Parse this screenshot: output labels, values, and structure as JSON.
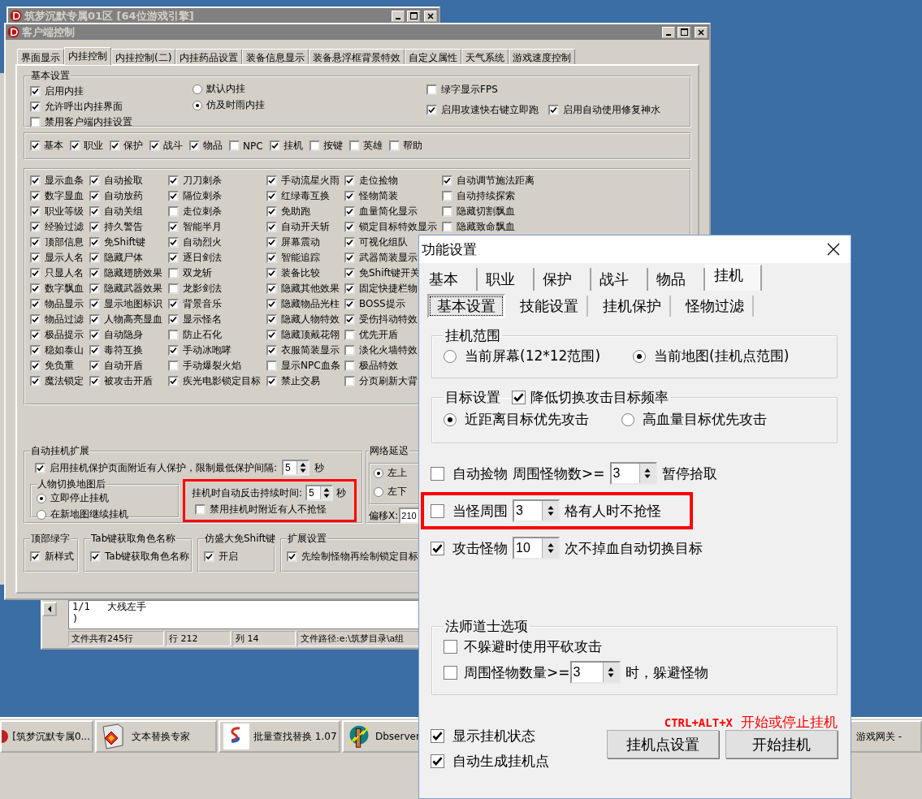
{
  "game_window": {
    "title": "筑梦沉默专属01区 [64位游戏引擎]"
  },
  "client_window": {
    "title": "客户端控制",
    "tabs": [
      {
        "label": "界面显示",
        "selected": false
      },
      {
        "label": "内挂控制",
        "selected": true
      },
      {
        "label": "内挂控制(二)",
        "selected": false
      },
      {
        "label": "内挂药品设置",
        "selected": false
      },
      {
        "label": "装备信息显示",
        "selected": false
      },
      {
        "label": "装备悬浮框背景特效",
        "selected": false
      },
      {
        "label": "自定义属性",
        "selected": false
      },
      {
        "label": "天气系统",
        "selected": false
      },
      {
        "label": "游戏速度控制",
        "selected": false
      }
    ],
    "basic_settings": {
      "title": "基本设置",
      "checkboxes": [
        {
          "label": "启用内挂",
          "checked": true
        },
        {
          "label": "允许呼出内挂界面",
          "checked": true
        },
        {
          "label": "禁用客户端内挂设置",
          "checked": false
        }
      ],
      "radios": [
        {
          "label": "默认内挂",
          "selected": false
        },
        {
          "label": "仿及时雨内挂",
          "selected": true
        }
      ],
      "right_checkboxes": [
        {
          "label": "绿字显示FPS",
          "checked": false
        },
        {
          "label": "启用攻速快右键立即跑",
          "checked": true
        },
        {
          "label": "启用自动使用修复神水",
          "checked": true
        }
      ]
    },
    "categories": [
      {
        "label": "基本",
        "checked": true
      },
      {
        "label": "职业",
        "checked": true
      },
      {
        "label": "保护",
        "checked": true
      },
      {
        "label": "战斗",
        "checked": true
      },
      {
        "label": "物品",
        "checked": true
      },
      {
        "label": "NPC",
        "checked": false
      },
      {
        "label": "挂机",
        "checked": true
      },
      {
        "label": "按键",
        "checked": false
      },
      {
        "label": "英雄",
        "checked": false
      },
      {
        "label": "帮助",
        "checked": false
      }
    ],
    "feature_columns": [
      [
        {
          "label": "显示血条",
          "checked": true
        },
        {
          "label": "数字显血",
          "checked": true
        },
        {
          "label": "职业等级",
          "checked": true
        },
        {
          "label": "经验过滤",
          "checked": true
        },
        {
          "label": "顶部信息",
          "checked": true
        },
        {
          "label": "显示人名",
          "checked": true
        },
        {
          "label": "只显人名",
          "checked": true
        },
        {
          "label": "数字飘血",
          "checked": true
        },
        {
          "label": "物品显示",
          "checked": true
        },
        {
          "label": "物品过滤",
          "checked": true
        },
        {
          "label": "极品提示",
          "checked": true
        },
        {
          "label": "稳如泰山",
          "checked": true
        },
        {
          "label": "免负重",
          "checked": true
        },
        {
          "label": "魔法锁定",
          "checked": true
        }
      ],
      [
        {
          "label": "自动捡取",
          "checked": true
        },
        {
          "label": "自动放药",
          "checked": true
        },
        {
          "label": "自动关组",
          "checked": true
        },
        {
          "label": "持久警告",
          "checked": true
        },
        {
          "label": "免Shift键",
          "checked": true
        },
        {
          "label": "隐藏尸体",
          "checked": true
        },
        {
          "label": "隐藏翅膀效果",
          "checked": true
        },
        {
          "label": "隐藏武器效果",
          "checked": true
        },
        {
          "label": "显示地图标识",
          "checked": true
        },
        {
          "label": "人物高亮显血",
          "checked": true
        },
        {
          "label": "自动隐身",
          "checked": true
        },
        {
          "label": "毒符互换",
          "checked": true
        },
        {
          "label": "自动开盾",
          "checked": true
        },
        {
          "label": "被攻击开盾",
          "checked": true
        }
      ],
      [
        {
          "label": "刀刀刺杀",
          "checked": true
        },
        {
          "label": "隔位刺杀",
          "checked": true
        },
        {
          "label": "走位刺杀",
          "checked": false
        },
        {
          "label": "智能半月",
          "checked": true
        },
        {
          "label": "自动烈火",
          "checked": true
        },
        {
          "label": "逐日剑法",
          "checked": true
        },
        {
          "label": "双龙斩",
          "checked": false
        },
        {
          "label": "龙影剑法",
          "checked": false
        },
        {
          "label": "背景音乐",
          "checked": true
        },
        {
          "label": "显示怪名",
          "checked": true
        },
        {
          "label": "防止石化",
          "checked": false
        },
        {
          "label": "手动冰咆哮",
          "checked": true
        },
        {
          "label": "手动爆裂火焰",
          "checked": false
        },
        {
          "label": "疾光电影锁定目标",
          "checked": true
        }
      ],
      [
        {
          "label": "手动流星火雨",
          "checked": true
        },
        {
          "label": "红绿毒互换",
          "checked": true
        },
        {
          "label": "免助跑",
          "checked": true
        },
        {
          "label": "自动开天斩",
          "checked": true
        },
        {
          "label": "屏幕震动",
          "checked": true
        },
        {
          "label": "智能追踪",
          "checked": true
        },
        {
          "label": "装备比较",
          "checked": true
        },
        {
          "label": "隐藏其他效果",
          "checked": true
        },
        {
          "label": "隐藏物品光柱",
          "checked": true
        },
        {
          "label": "隐藏人物特效",
          "checked": true
        },
        {
          "label": "隐藏顶戴花翎",
          "checked": true
        },
        {
          "label": "衣服简装显示",
          "checked": true
        },
        {
          "label": "显示NPC血条",
          "checked": false
        },
        {
          "label": "禁止交易",
          "checked": true
        }
      ],
      [
        {
          "label": "走位捡物",
          "checked": true
        },
        {
          "label": "怪物简装",
          "checked": true
        },
        {
          "label": "血量简化显示",
          "checked": true
        },
        {
          "label": "锁定目标特效显示",
          "checked": true
        },
        {
          "label": "可视化组队",
          "checked": true
        },
        {
          "label": "武器简装显示",
          "checked": true
        },
        {
          "label": "免Shift键开关",
          "checked": true
        },
        {
          "label": "固定快捷栏物",
          "checked": true
        },
        {
          "label": "BOSS提示",
          "checked": true
        },
        {
          "label": "受伤抖动特效",
          "checked": true
        },
        {
          "label": "优先开盾",
          "checked": false
        },
        {
          "label": "淡化火墙特效",
          "checked": false
        },
        {
          "label": "极品特效",
          "checked": false
        },
        {
          "label": "分页刷新大背",
          "checked": false
        }
      ],
      [
        {
          "label": "自动调节施法距离",
          "checked": true
        },
        {
          "label": "自动持续探索",
          "checked": false
        },
        {
          "label": "隐藏切割飘血",
          "checked": false
        },
        {
          "label": "隐藏致命飘血",
          "checked": false
        }
      ]
    ],
    "auto_hangup": {
      "title": "自动挂机扩展",
      "protect": {
        "label": "启用挂机保护页面附近有人保护，限制最低保护间隔:",
        "checked": true,
        "value": "5",
        "unit": "秒"
      },
      "map_switch": {
        "title": "人物切换地图后",
        "radios": [
          {
            "label": "立即停止挂机",
            "selected": true
          },
          {
            "label": "在新地图继续挂机",
            "selected": false
          }
        ]
      },
      "counter": {
        "highlighted": true,
        "label": "挂机时自动反击持续时间:",
        "value": "5",
        "unit": "秒",
        "checkbox": {
          "label": "禁用挂机时附近有人不抢怪",
          "checked": false
        }
      }
    },
    "network": {
      "title": "网络延迟",
      "radios": [
        {
          "label": "左上",
          "selected": true
        },
        {
          "label": "左下",
          "selected": false
        }
      ],
      "offset_label": "偏移X:",
      "offset_value": "210"
    },
    "bottom_groups": [
      {
        "title": "顶部绿字",
        "label": "新样式",
        "checked": true
      },
      {
        "title": "Tab键获取角色名称",
        "label": "Tab键获取角色名称",
        "checked": true
      },
      {
        "title": "仿盛大免Shift键",
        "label": "开启",
        "checked": true
      },
      {
        "title": "扩展设置",
        "label": "先绘制怪物再绘制锁定目标",
        "checked": true
      }
    ]
  },
  "editor_window": {
    "lines": [
      "1/1   大残左手",
      ")"
    ],
    "status": [
      "文件共有245行",
      "行 212",
      "列 14",
      "文件路径:e:\\筑梦目录\\a组"
    ]
  },
  "dialog": {
    "title": "功能设置",
    "tabs": [
      {
        "label": "基本",
        "selected": false
      },
      {
        "label": "职业",
        "selected": false
      },
      {
        "label": "保护",
        "selected": false
      },
      {
        "label": "战斗",
        "selected": false
      },
      {
        "label": "物品",
        "selected": false
      },
      {
        "label": "挂机",
        "selected": true
      }
    ],
    "subtabs": [
      {
        "label": "基本设置",
        "selected": true
      },
      {
        "label": "技能设置",
        "selected": false
      },
      {
        "label": "挂机保护",
        "selected": false
      },
      {
        "label": "怪物过滤",
        "selected": false
      }
    ],
    "range": {
      "title": "挂机范围",
      "radios": [
        {
          "label": "当前屏幕(12*12范围)",
          "selected": false
        },
        {
          "label": "当前地图(挂机点范围)",
          "selected": true
        }
      ]
    },
    "target": {
      "title": "目标设置",
      "checkbox": {
        "label": "降低切换攻击目标频率",
        "checked": true
      },
      "radios": [
        {
          "label": "近距离目标优先攻击",
          "selected": true
        },
        {
          "label": "高血量目标优先攻击",
          "selected": false
        }
      ]
    },
    "rows": [
      {
        "label": "自动捡物",
        "checked": false,
        "middle": "周围怪物数>=",
        "value": "3",
        "suffix": "暂停拾取",
        "highlighted": false
      },
      {
        "label": "当怪周围",
        "checked": false,
        "value": "3",
        "suffix": "格有人时不抢怪",
        "highlighted": true
      },
      {
        "label": "攻击怪物",
        "checked": true,
        "value": "10",
        "suffix": "次不掉血自动切换目标",
        "highlighted": false
      }
    ],
    "mage": {
      "title": "法师道士选项",
      "items": [
        {
          "label": "不躲避时使用平砍攻击",
          "checked": false
        },
        {
          "label": "周围怪物数量>=",
          "checked": false,
          "value": "3",
          "suffix": "时，躲避怪物"
        }
      ]
    },
    "hotkey": "CTRL+ALT+X",
    "hotkey_action": "开始或停止挂机",
    "options": [
      {
        "label": "显示挂机状态",
        "checked": true
      },
      {
        "label": "自动生成挂机点",
        "checked": true
      }
    ],
    "buttons": [
      "挂机点设置",
      "开始挂机"
    ]
  },
  "taskbar": [
    {
      "label": "[筑梦沉默专属0...",
      "kind": "game"
    },
    {
      "label": "文本替换专家",
      "kind": "replace"
    },
    {
      "label": "批量查找替换 1.07",
      "kind": "batch"
    },
    {
      "label": "Dbserver",
      "kind": "server"
    },
    {
      "label": "游戏网关 -",
      "kind": "gateway"
    }
  ]
}
